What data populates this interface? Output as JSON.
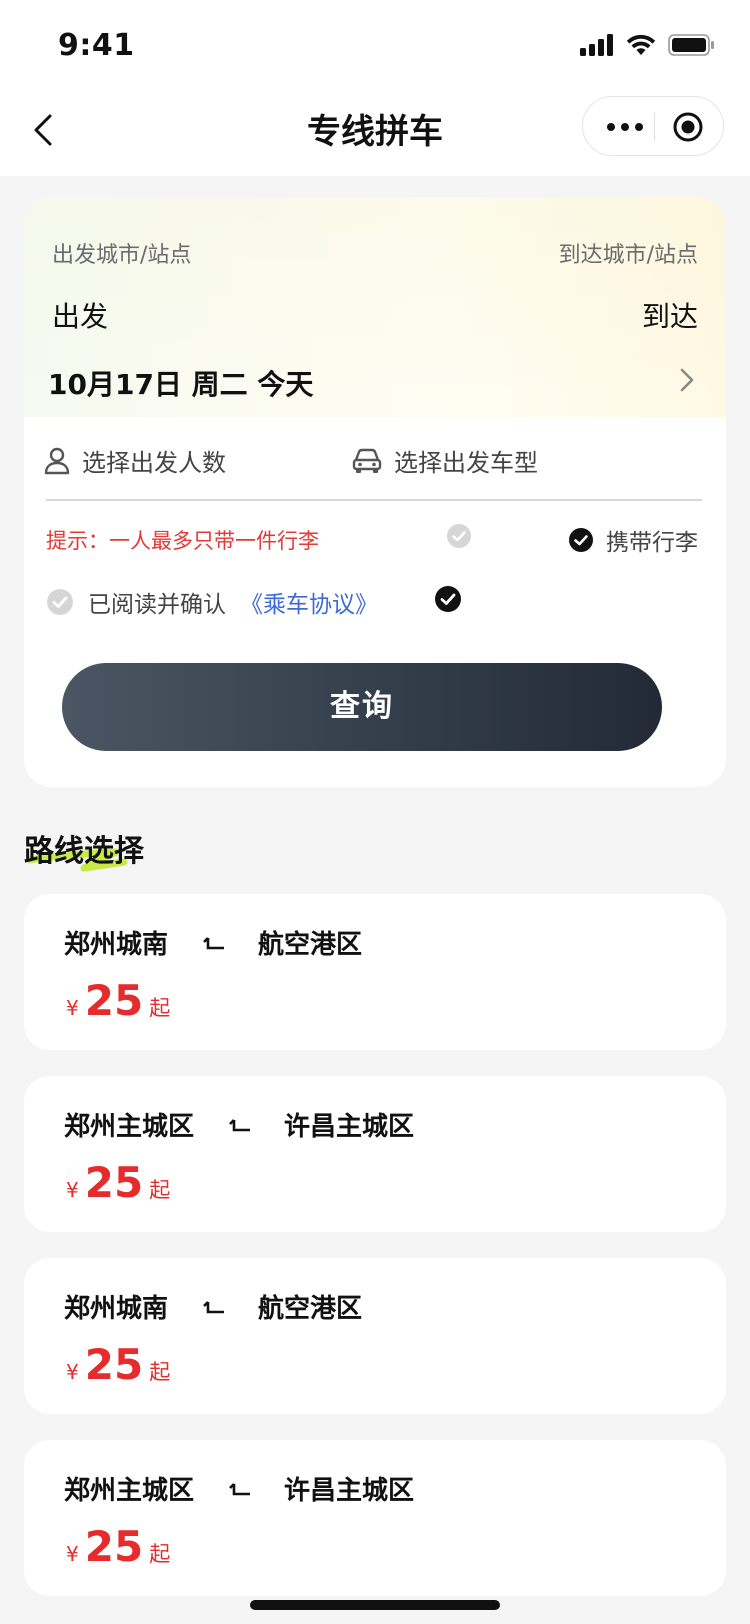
{
  "status_bar": {
    "time": "9:41"
  },
  "nav": {
    "title": "专线拼车"
  },
  "search": {
    "from_label": "出发城市/站点",
    "to_label": "到达城市/站点",
    "from_value": "出发",
    "to_value": "到达",
    "date": "10月17日 周二 今天",
    "people_placeholder": "选择出发人数",
    "car_placeholder": "选择出发车型",
    "hint": "提示：一人最多只带一件行李",
    "luggage_label": "携带行李",
    "agree_text": "已阅读并确认",
    "agree_link": "《乘车协议》",
    "query_label": "查询"
  },
  "routes_section": {
    "title": "路线选择"
  },
  "routes": [
    {
      "from": "郑州城南",
      "to": "航空港区",
      "currency": "¥",
      "price": "25",
      "suffix": "起"
    },
    {
      "from": "郑州主城区",
      "to": "许昌主城区",
      "currency": "¥",
      "price": "25",
      "suffix": "起"
    },
    {
      "from": "郑州城南",
      "to": "航空港区",
      "currency": "¥",
      "price": "25",
      "suffix": "起"
    },
    {
      "from": "郑州主城区",
      "to": "许昌主城区",
      "currency": "¥",
      "price": "25",
      "suffix": "起"
    }
  ],
  "icons": {
    "back": "chevron-left-icon",
    "more": "more-dots-icon",
    "record": "record-icon",
    "chevron": "chevron-right-icon",
    "person": "person-icon",
    "car": "car-icon",
    "check": "check-circle-icon",
    "arrow": "route-arrow-icon"
  },
  "colors": {
    "accent_red": "#e52b2b",
    "link_blue": "#3d6ad6",
    "button_dark": "#222a36"
  }
}
